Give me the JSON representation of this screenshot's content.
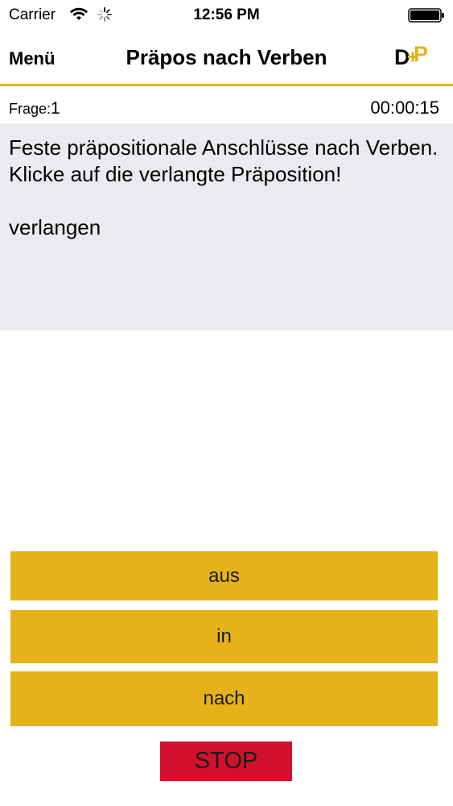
{
  "status_bar": {
    "carrier": "Carrier",
    "time": "12:56 PM",
    "icons": [
      "wifi-icon",
      "spinner-icon",
      "battery-icon"
    ]
  },
  "nav": {
    "menu_label": "Menü",
    "title": "Präpos nach Verben",
    "logo_left": "D",
    "logo_right": "P"
  },
  "quiz": {
    "frage_label": "Frage:",
    "frage_number": "1",
    "timer": "00:00:15",
    "question": "Feste präpositionale Anschlüsse nach Verben.\nKlicke auf die verlangte Präposition!\n\nverlangen",
    "answers": [
      "aus",
      "in",
      "nach"
    ],
    "stop_label": "STOP"
  },
  "colors": {
    "accent": "#e6b21a",
    "stop": "#d1112b",
    "question_bg": "#ebebef"
  }
}
